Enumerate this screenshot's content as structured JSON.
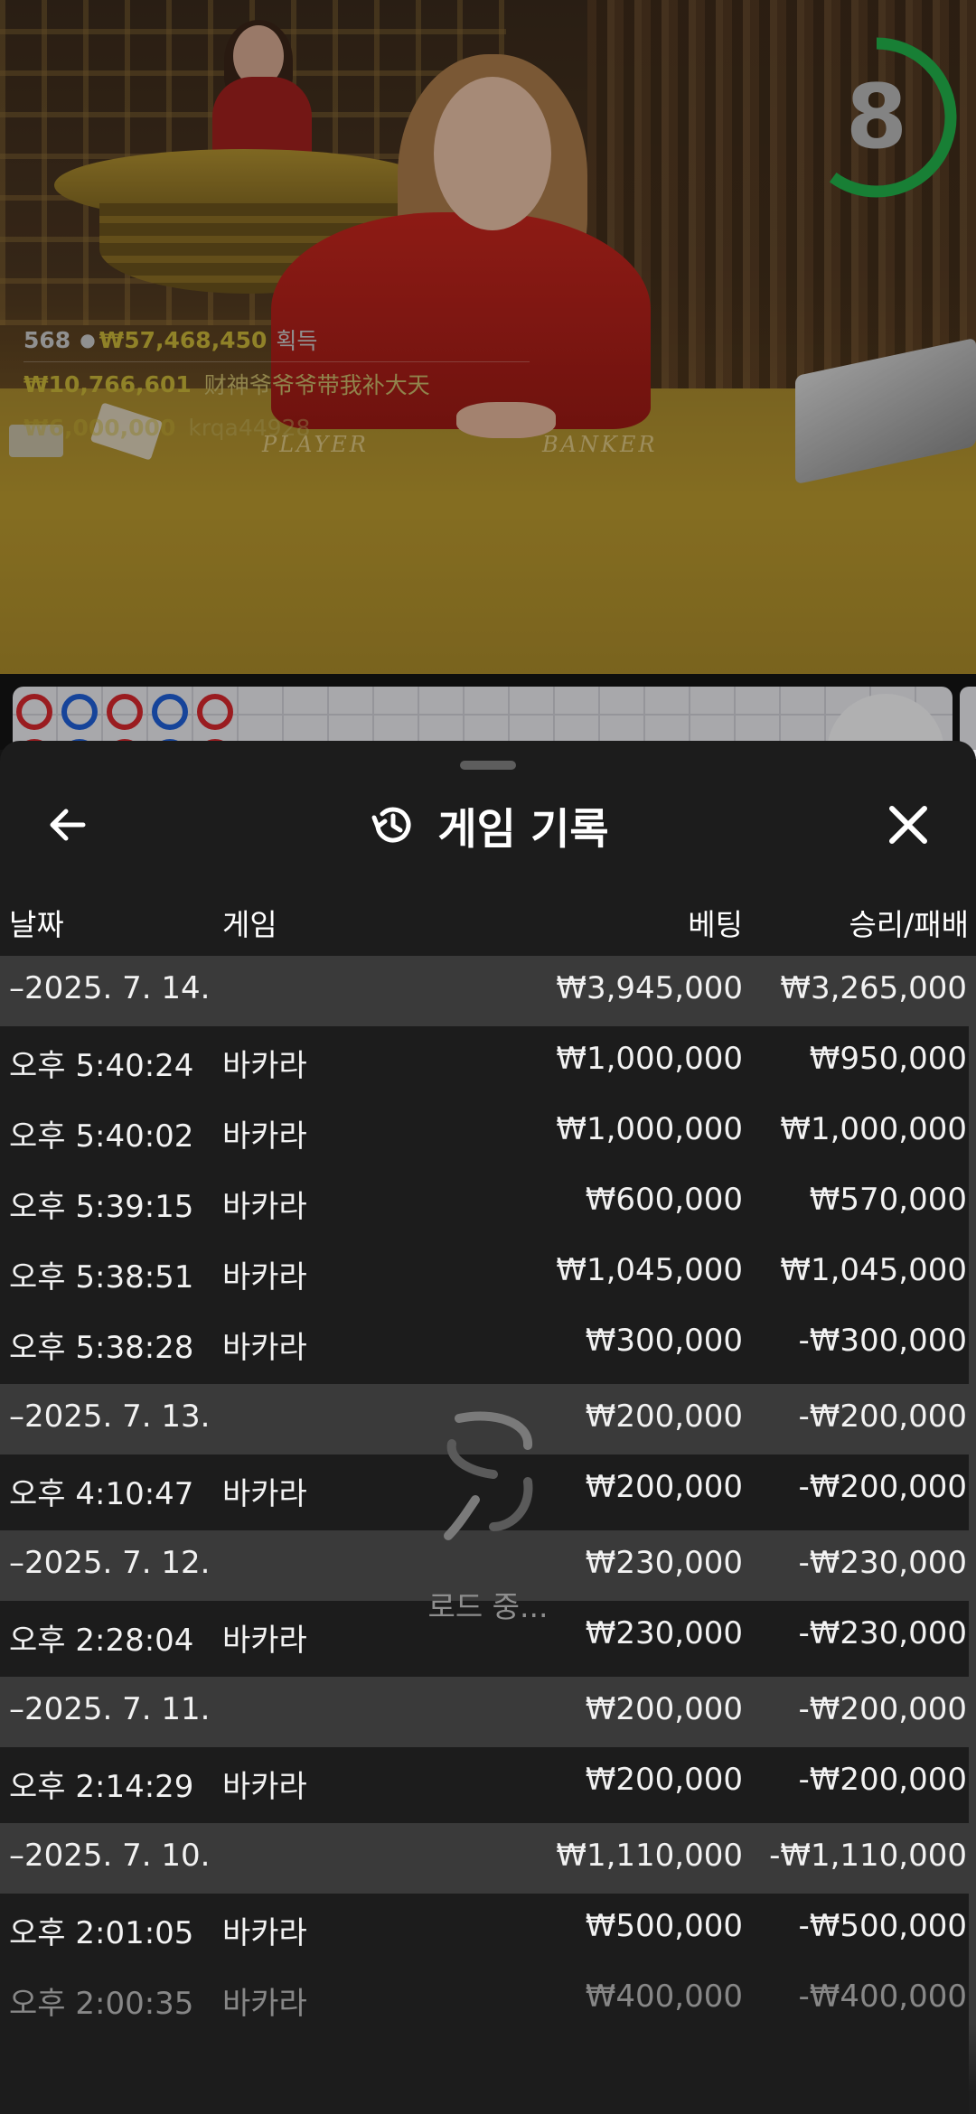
{
  "video": {
    "timer": {
      "value": "8",
      "progress": 0.6
    },
    "felt_labels": {
      "player": "PLAYER",
      "banker": "BANKER"
    },
    "winners": {
      "player_count": "568",
      "total_amount": "₩57,468,450",
      "total_label": "획득",
      "entries": [
        {
          "amount": "₩10,766,601",
          "name": "财神爷爷爷带我补大天"
        },
        {
          "amount": "₩6,000,000",
          "name": "krqa44928"
        }
      ]
    }
  },
  "road": {
    "colors": {
      "player": "#1f5fd6",
      "banker": "#d6272d"
    },
    "top_row": [
      "banker",
      "player",
      "banker",
      "player",
      "banker"
    ]
  },
  "history": {
    "title": "게임 기록",
    "icons": {
      "back": "arrow-left-icon",
      "history": "history-icon",
      "close": "close-icon"
    },
    "columns": {
      "date": "날짜",
      "game": "게임",
      "bet": "베팅",
      "winloss": "승리/패배"
    },
    "rows": [
      {
        "type": "day",
        "time": "–2025. 7. 14.",
        "game": "",
        "bet": "₩3,945,000",
        "result": "₩3,265,000"
      },
      {
        "type": "game",
        "time": "오후 5:40:24",
        "game": "바카라",
        "bet": "₩1,000,000",
        "result": "₩950,000"
      },
      {
        "type": "game",
        "time": "오후 5:40:02",
        "game": "바카라",
        "bet": "₩1,000,000",
        "result": "₩1,000,000"
      },
      {
        "type": "game",
        "time": "오후 5:39:15",
        "game": "바카라",
        "bet": "₩600,000",
        "result": "₩570,000"
      },
      {
        "type": "game",
        "time": "오후 5:38:51",
        "game": "바카라",
        "bet": "₩1,045,000",
        "result": "₩1,045,000"
      },
      {
        "type": "game",
        "time": "오후 5:38:28",
        "game": "바카라",
        "bet": "₩300,000",
        "result": "-₩300,000"
      },
      {
        "type": "day",
        "time": "–2025. 7. 13.",
        "game": "",
        "bet": "₩200,000",
        "result": "-₩200,000"
      },
      {
        "type": "game",
        "time": "오후 4:10:47",
        "game": "바카라",
        "bet": "₩200,000",
        "result": "-₩200,000"
      },
      {
        "type": "day",
        "time": "–2025. 7. 12.",
        "game": "",
        "bet": "₩230,000",
        "result": "-₩230,000"
      },
      {
        "type": "game",
        "time": "오후 2:28:04",
        "game": "바카라",
        "bet": "₩230,000",
        "result": "-₩230,000"
      },
      {
        "type": "day",
        "time": "–2025. 7. 11.",
        "game": "",
        "bet": "₩200,000",
        "result": "-₩200,000"
      },
      {
        "type": "game",
        "time": "오후 2:14:29",
        "game": "바카라",
        "bet": "₩200,000",
        "result": "-₩200,000"
      },
      {
        "type": "day",
        "time": "–2025. 7. 10.",
        "game": "",
        "bet": "₩1,110,000",
        "result": "-₩1,110,000"
      },
      {
        "type": "game",
        "time": "오후 2:01:05",
        "game": "바카라",
        "bet": "₩500,000",
        "result": "-₩500,000"
      },
      {
        "type": "game",
        "time": "오후 2:00:35",
        "game": "바카라",
        "bet": "₩400,000",
        "result": "-₩400,000"
      }
    ],
    "loading_text": "로드 중..."
  }
}
